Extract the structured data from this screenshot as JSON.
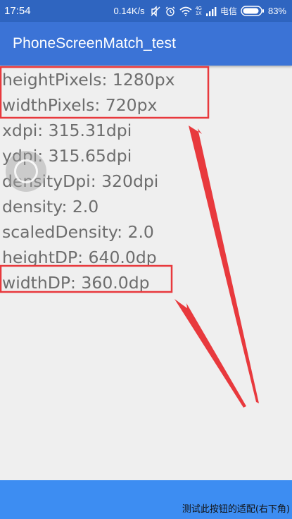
{
  "status_bar": {
    "time": "17:54",
    "network_speed": "0.14K/s",
    "network_type_top": "4G",
    "network_type_bottom": "1X",
    "carrier": "电信",
    "battery_percent": "83%"
  },
  "app_bar": {
    "title": "PhoneScreenMatch_test"
  },
  "metrics": [
    "heightPixels: 1280px",
    "widthPixels: 720px",
    "xdpi: 315.31dpi",
    "ydpi: 315.65dpi",
    "densityDpi: 320dpi",
    "density: 2.0",
    "scaledDensity: 2.0",
    "heightDP: 640.0dp",
    "widthDP: 360.0dp"
  ],
  "bottom_button": {
    "label": "测试此按钮的适配(右下角)"
  },
  "colors": {
    "status_bar": "#2f65c0",
    "app_bar": "#3b73d6",
    "background": "#efefef",
    "text": "#6d6d6d",
    "highlight": "#e8393d",
    "bottom_button": "#3d8df2"
  }
}
